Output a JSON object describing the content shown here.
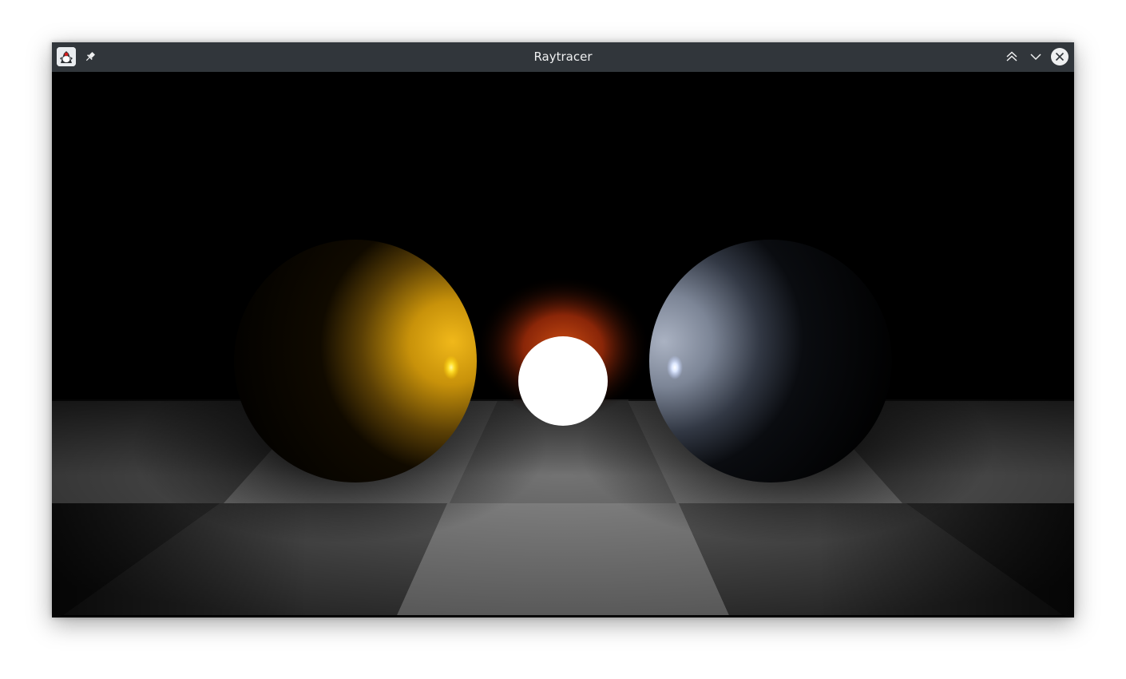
{
  "window": {
    "title": "Raytracer",
    "titlebar_color": "#31363b",
    "title_color": "#eff0f1"
  },
  "titlebar": {
    "app_icon": "java-duke-icon",
    "pin_icon": "pin-icon",
    "buttons": [
      "keep-above-icon",
      "minimize-icon",
      "close-icon"
    ]
  },
  "scene": {
    "background_color": "#000000",
    "floor": "checkerboard",
    "spheres": [
      {
        "name": "gold-sphere",
        "color": "#c8920a"
      },
      {
        "name": "white-light-sphere",
        "color": "#ffffff",
        "glow_color": "#b8360a"
      },
      {
        "name": "silver-sphere",
        "color": "#9aa4b4"
      }
    ]
  }
}
